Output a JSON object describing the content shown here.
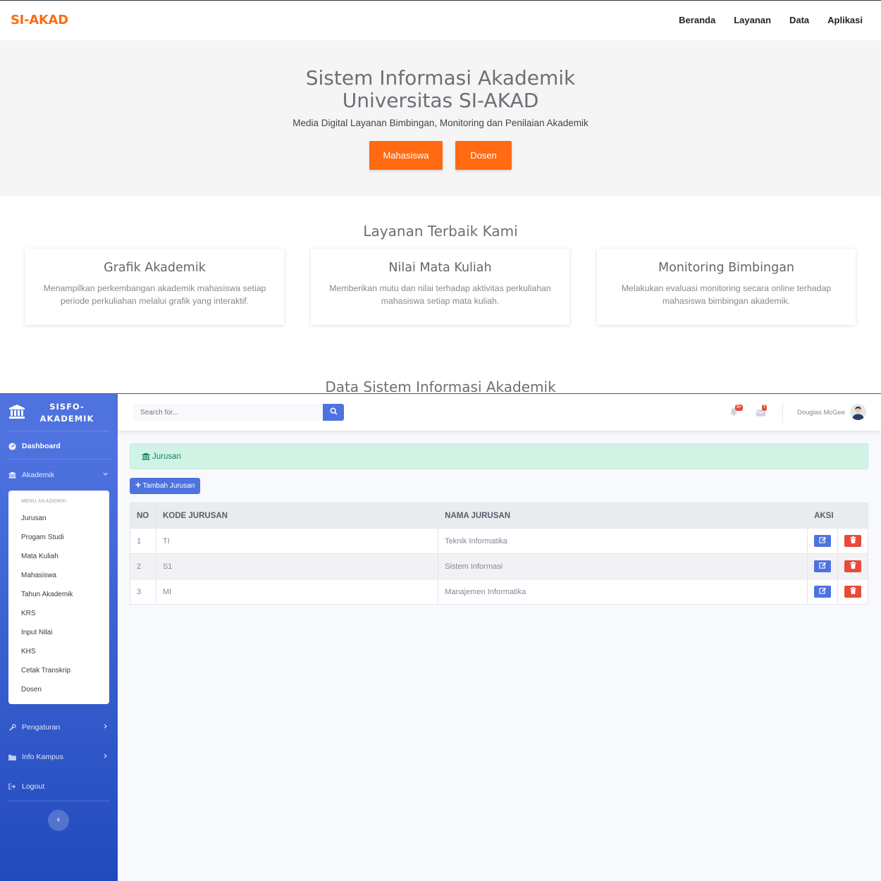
{
  "landing": {
    "brand": "SI-AKAD",
    "nav": [
      "Beranda",
      "Layanan",
      "Data",
      "Aplikasi"
    ],
    "hero": {
      "title_line1": "Sistem Informasi Akademik",
      "title_line2": "Universitas SI-AKAD",
      "subtitle": "Media Digital Layanan Bimbingan, Monitoring dan Penilaian Akademik",
      "btn_mahasiswa": "Mahasiswa",
      "btn_dosen": "Dosen"
    },
    "services_title": "Layanan Terbaik Kami",
    "cards": [
      {
        "title": "Grafik Akademik",
        "text": "Menampilkan perkembangan akademik mahasiswa setiap periode perkuliahan melalui grafik yang interaktif."
      },
      {
        "title": "Nilai Mata Kuliah",
        "text": "Memberikan mutu dan nilai terhadap aktivitas perkuliahan mahasiswa setiap mata kuliah."
      },
      {
        "title": "Monitoring Bimbingan",
        "text": "Melakukan evaluasi monitoring secara online terhadap mahasiswa bimbingan akademik."
      }
    ],
    "data_title": "Data Sistem Informasi Akademik"
  },
  "admin": {
    "sidebar": {
      "brand_line1": "SISFO-",
      "brand_line2": "AKADEMIK",
      "dashboard": "Dashboard",
      "akademik": "Akademik",
      "submenu_header": "MENU AKADEMIK:",
      "submenu": [
        "Jurusan",
        "Progam Studi",
        "Mata Kuliah",
        "Mahasiswa",
        "Tahun Akademik",
        "KRS",
        "Input Nilai",
        "KHS",
        "Cetak Transkrip",
        "Dosen"
      ],
      "pengaturan": "Pengaturan",
      "info_kampus": "Info Kampus",
      "logout": "Logout"
    },
    "topbar": {
      "search_placeholder": "Search for...",
      "alerts_badge": "3+",
      "messages_badge": "7",
      "user_name": "Douglas McGee"
    },
    "page": {
      "alert_title": "Jurusan",
      "add_button": "Tambah Jurusan",
      "columns": [
        "NO",
        "KODE JURUSAN",
        "NAMA JURUSAN",
        "AKSI"
      ],
      "rows": [
        {
          "no": "1",
          "kode": "TI",
          "nama": "Teknik Informatika"
        },
        {
          "no": "2",
          "kode": "S1",
          "nama": "Sistem Informasi"
        },
        {
          "no": "3",
          "kode": "MI",
          "nama": "Manajemen Informatika"
        }
      ]
    },
    "colors": {
      "primary": "#4e73df",
      "danger": "#e74a3b",
      "success_bg": "#d1f3e6",
      "accent": "#ff6a13"
    }
  }
}
